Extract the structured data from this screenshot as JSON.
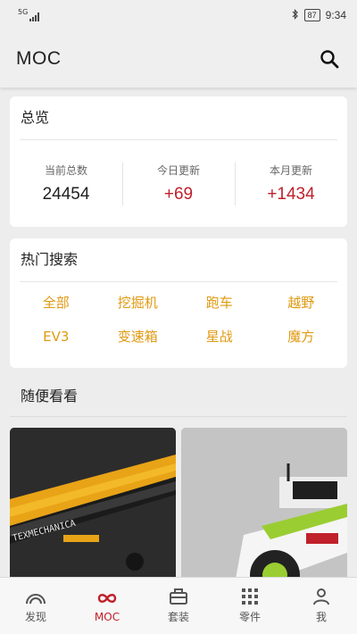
{
  "status_bar": {
    "network": "5G",
    "battery": "87",
    "time": "9:34"
  },
  "app_bar": {
    "title": "MOC"
  },
  "overview": {
    "title": "总览",
    "stats": [
      {
        "label": "当前总数",
        "value": "24454"
      },
      {
        "label": "今日更新",
        "value": "+69"
      },
      {
        "label": "本月更新",
        "value": "+1434"
      }
    ]
  },
  "hot_search": {
    "title": "热门搜索",
    "tags": [
      "全部",
      "挖掘机",
      "跑车",
      "越野",
      "EV3",
      "变速箱",
      "星战",
      "魔方"
    ]
  },
  "random": {
    "title": "随便看看",
    "thumb_text": "TEXMECHANICA"
  },
  "bottom_nav": {
    "items": [
      {
        "label": "发现",
        "icon": "rainbow-arc-icon"
      },
      {
        "label": "MOC",
        "icon": "infinity-icon"
      },
      {
        "label": "套装",
        "icon": "briefcase-icon"
      },
      {
        "label": "零件",
        "icon": "grid-dots-icon"
      },
      {
        "label": "我",
        "icon": "person-icon"
      }
    ],
    "active_index": 1
  },
  "colors": {
    "accent_red": "#c0202a",
    "tag_orange": "#e09a12",
    "background": "#ededed"
  }
}
